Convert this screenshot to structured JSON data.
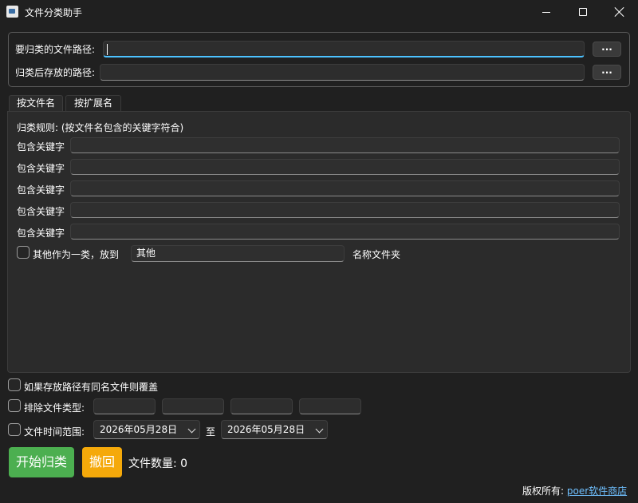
{
  "window": {
    "title": "文件分类助手",
    "icon": "folder-icon"
  },
  "paths": {
    "source_label": "要归类的文件路径:",
    "source_value": "",
    "target_label": "归类后存放的路径:",
    "target_value": "",
    "browse_label": "..."
  },
  "tabs": [
    {
      "label": "按文件名",
      "active": true
    },
    {
      "label": "按扩展名",
      "active": false
    }
  ],
  "rules": {
    "title": "归类规则: (按文件名包含的关键字符合)",
    "keyword_label": "包含关键字",
    "keywords": [
      "",
      "",
      "",
      "",
      ""
    ],
    "other_label": "其他作为一类，放到",
    "other_value": "其他",
    "folder_suffix": "名称文件夹"
  },
  "options": {
    "overwrite_label": "如果存放路径有同名文件则覆盖",
    "exclude_label": "排除文件类型:",
    "exclude_types": [
      "",
      "",
      "",
      ""
    ],
    "time_label": "文件时间范围:",
    "date_from": "2026年05月28日",
    "date_to_sep": "至",
    "date_to": "2026年05月28日"
  },
  "actions": {
    "start_label": "开始归类",
    "undo_label": "撤回",
    "file_count_label": "文件数量: 0"
  },
  "footer": {
    "copyright_prefix": "版权所有:",
    "copyright_link": "poer软件商店"
  },
  "colors": {
    "start": "#4caf50",
    "undo": "#f5a90a",
    "link": "#6fc0ff",
    "focus": "#4cc2ff"
  }
}
